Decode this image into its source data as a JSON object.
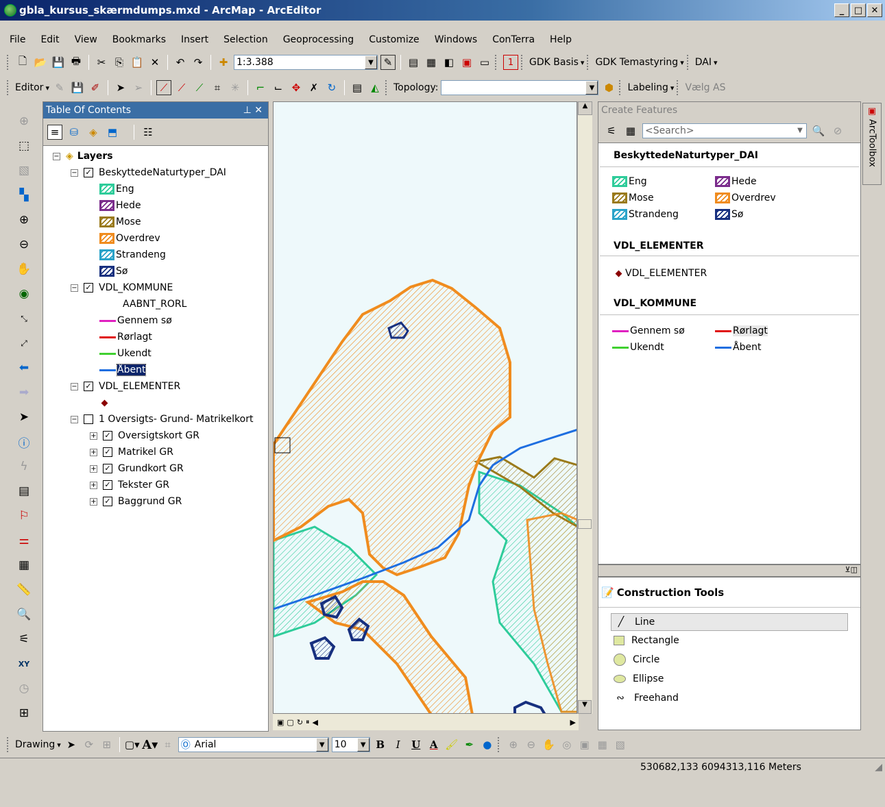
{
  "window": {
    "title": "gbla_kursus_skærmdumps.mxd - ArcMap - ArcEditor"
  },
  "menu": [
    "File",
    "Edit",
    "View",
    "Bookmarks",
    "Insert",
    "Selection",
    "Geoprocessing",
    "Customize",
    "Windows",
    "ConTerra",
    "Help"
  ],
  "standard_toolbar": {
    "scale": "1:3.388",
    "badge": "1",
    "gdk_basis": "GDK Basis",
    "gdk_temastyring": "GDK Temastyring",
    "dai": "DAI"
  },
  "editor_toolbar": {
    "editor": "Editor",
    "topology_label": "Topology:",
    "labeling": "Labeling",
    "vaelg": "Vælg AS"
  },
  "toc": {
    "title": "Table Of Contents",
    "root": "Layers",
    "layer1": {
      "name": "BeskyttedeNaturtyper_DAI",
      "classes": [
        "Eng",
        "Hede",
        "Mose",
        "Overdrev",
        "Strandeng",
        "Sø"
      ]
    },
    "layer2": {
      "name": "VDL_KOMMUNE",
      "field": "AABNT_RORL",
      "classes": [
        "Gennem sø",
        "Rørlagt",
        "Ukendt",
        "Åbent"
      ]
    },
    "layer3": {
      "name": "VDL_ELEMENTER"
    },
    "group": {
      "name": "1 Oversigts- Grund- Matrikelkort",
      "children": [
        "Oversigtskort GR",
        "Matrikel GR",
        "Grundkort GR",
        "Tekster GR",
        "Baggrund GR"
      ]
    }
  },
  "create_features": {
    "title": "Create Features",
    "search_placeholder": "<Search>",
    "group1": "BeskyttedeNaturtyper_DAI",
    "group1_items": [
      "Eng",
      "Hede",
      "Mose",
      "Overdrev",
      "Strandeng",
      "Sø"
    ],
    "group2": "VDL_ELEMENTER",
    "group2_items": [
      "VDL_ELEMENTER"
    ],
    "group3": "VDL_KOMMUNE",
    "group3_items": [
      "Gennem sø",
      "Rørlagt",
      "Ukendt",
      "Åbent"
    ]
  },
  "construction_tools": {
    "title": "Construction Tools",
    "items": [
      "Line",
      "Rectangle",
      "Circle",
      "Ellipse",
      "Freehand"
    ]
  },
  "arctoolbox": "ArcToolbox",
  "drawing_toolbar": {
    "drawing": "Drawing",
    "font": "Arial",
    "size": "10",
    "bold": "B",
    "italic": "I",
    "underline": "U",
    "text_a": "A"
  },
  "status": {
    "coordinates": "530682,133 6094313,116 Meters"
  },
  "colors": {
    "eng": "#2ecc9a",
    "hede": "#7b2c8c",
    "mose": "#9a7a1a",
    "overdrev": "#f08c1e",
    "strandeng": "#29a3c9",
    "so": "#17307f",
    "gennem_so": "#e020c0",
    "rorlagt": "#e01010",
    "ukendt": "#40d030",
    "abent": "#1e6ee0"
  }
}
